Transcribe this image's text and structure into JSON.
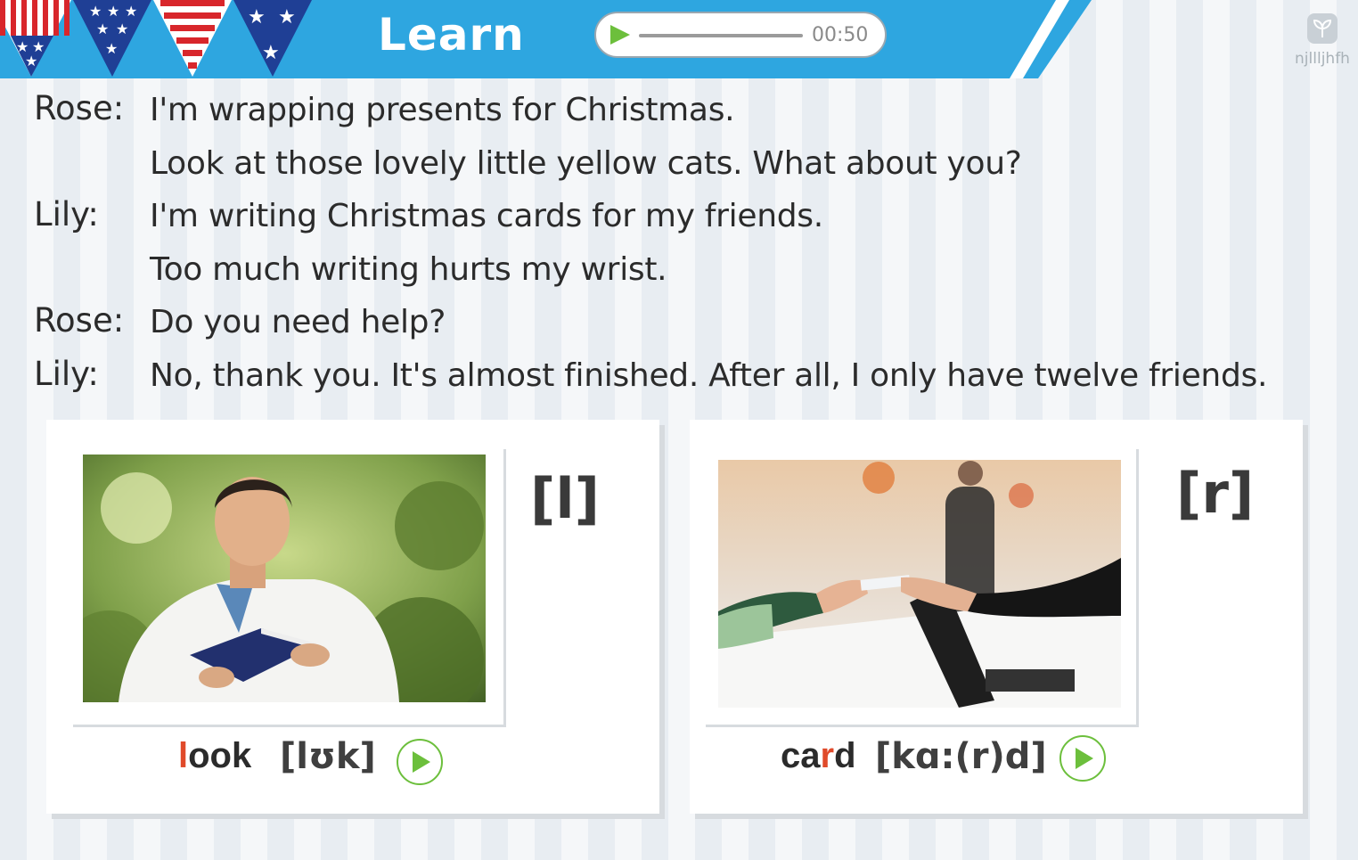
{
  "header": {
    "title": "Learn",
    "audio": {
      "time": "00:50",
      "progress": 0.0
    },
    "accent_color": "#2ea6e0",
    "logo": {
      "icon": "sprout-logo-icon",
      "text": "njllljhfh"
    }
  },
  "dialogue": [
    {
      "speaker": "Rose:",
      "text": "I'm wrapping presents for Christmas."
    },
    {
      "speaker": "",
      "text": "Look at those lovely little yellow cats. What about you?"
    },
    {
      "speaker": "Lily:",
      "text": "I'm writing Christmas cards for my friends."
    },
    {
      "speaker": "",
      "text": "Too much writing hurts my wrist."
    },
    {
      "speaker": "Rose:",
      "text": "Do you need help?"
    },
    {
      "speaker": "Lily:",
      "text": "No, thank you. It's almost finished. After all, I only have twelve friends."
    }
  ],
  "cards": [
    {
      "phoneme": "[l]",
      "word_highlight": "l",
      "word_rest": "ook",
      "ipa": "[lʊk]",
      "image": "man-reading-book-photo"
    },
    {
      "phoneme": "[r]",
      "word_before": "ca",
      "word_highlight": "r",
      "word_after": "d",
      "ipa": "[kɑ:(r)d]",
      "image": "handing-card-photo"
    }
  ],
  "colors": {
    "highlight": "#e04a2a",
    "play_green": "#6cbf3c"
  }
}
